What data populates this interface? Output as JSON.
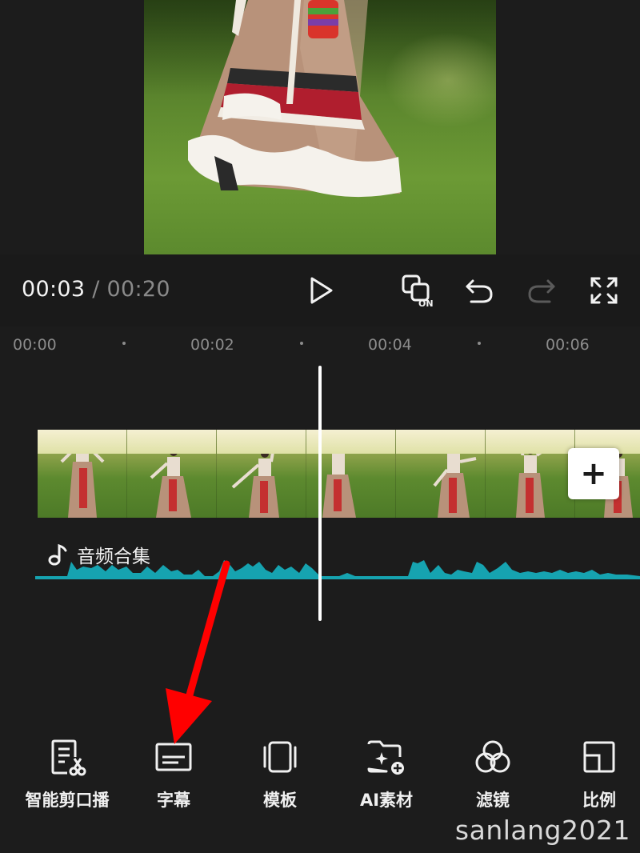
{
  "player": {
    "current_time": "00:03",
    "separator": "/",
    "total_time": "00:20",
    "play_icon": "play-icon",
    "link_icon": "link-on-icon",
    "link_badge": "ON",
    "undo_icon": "undo-icon",
    "redo_icon": "redo-icon",
    "fullscreen_icon": "fullscreen-icon"
  },
  "ruler": {
    "ticks": [
      "00:00",
      "00:02",
      "00:04",
      "00:06"
    ]
  },
  "timeline": {
    "add_clip_label": "+",
    "audio_track_label": "音频合集",
    "audio_icon": "music-note-icon",
    "playhead_color": "#ffffff",
    "waveform_color": "#16a3b0"
  },
  "toolbar": {
    "items": [
      {
        "label": "智能剪口播",
        "icon": "smart-cut-icon"
      },
      {
        "label": "字幕",
        "icon": "subtitle-icon"
      },
      {
        "label": "模板",
        "icon": "template-icon"
      },
      {
        "label": "AI素材",
        "icon": "ai-material-icon"
      },
      {
        "label": "滤镜",
        "icon": "filter-icon"
      },
      {
        "label": "比例",
        "icon": "ratio-icon"
      }
    ]
  },
  "annotation": {
    "arrow_color": "#ff0000",
    "target": "字幕"
  },
  "watermark": "sanlang2021"
}
